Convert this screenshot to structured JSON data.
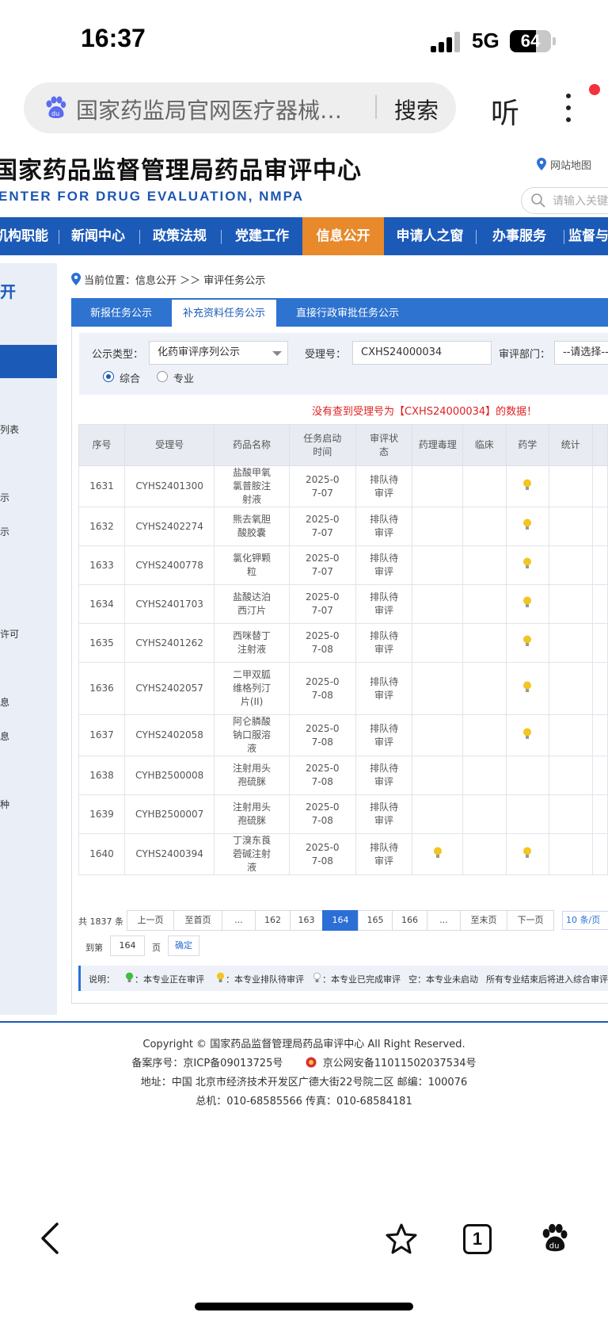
{
  "status_bar": {
    "time": "16:37",
    "network": "5G",
    "battery": "64",
    "battery_level": 0.64
  },
  "browser": {
    "search_query": "国家药监局官网医疗器械…",
    "search_label": "搜索",
    "listen_label": "听"
  },
  "site": {
    "title": "国家药品监督管理局药品审评中心",
    "subtitle": "ENTER FOR DRUG EVALUATION, NMPA",
    "sitemap": "网站地图",
    "search_placeholder": "请输入关键词"
  },
  "nav": [
    "机构职能",
    "新闻中心",
    "政策法规",
    "党建工作",
    "信息公开",
    "申请人之窗",
    "办事服务",
    "监督与"
  ],
  "sidebar": {
    "heading": "开",
    "items": [
      "列表",
      "示",
      "示",
      "许可",
      "息",
      "息",
      "种"
    ]
  },
  "breadcrumb": "当前位置：信息公开 ＞＞ 审评任务公示",
  "tabs": [
    "新报任务公示",
    "补充资料任务公示",
    "直接行政审批任务公示"
  ],
  "filters": {
    "type_label": "公示类型：",
    "type_value": "化药审评序列公示",
    "accept_label": "受理号：",
    "accept_value": "CXHS24000034",
    "dept_label": "审评部门：",
    "dept_value": "--请选择--",
    "radio_all": "综合",
    "radio_major": "专业"
  },
  "not_found": "没有查到受理号为【CXHS24000034】的数据！",
  "table": {
    "headers": [
      "序号",
      "受理号",
      "药品名称",
      "任务启动时间",
      "审评状态",
      "药理毒理",
      "临床",
      "药学",
      "统计",
      ""
    ],
    "rows": [
      {
        "no": "1631",
        "accept": "CYHS2401300",
        "name": "盐酸甲氧氯普胺注射液",
        "date": "2025-07-07",
        "status": "排队待审评",
        "tox": false,
        "pharm": true
      },
      {
        "no": "1632",
        "accept": "CYHS2402274",
        "name": "熊去氧胆酸胶囊",
        "date": "2025-07-07",
        "status": "排队待审评",
        "tox": false,
        "pharm": true
      },
      {
        "no": "1633",
        "accept": "CYHS2400778",
        "name": "氯化钾颗粒",
        "date": "2025-07-07",
        "status": "排队待审评",
        "tox": false,
        "pharm": true
      },
      {
        "no": "1634",
        "accept": "CYHS2401703",
        "name": "盐酸达泊西汀片",
        "date": "2025-07-07",
        "status": "排队待审评",
        "tox": false,
        "pharm": true
      },
      {
        "no": "1635",
        "accept": "CYHS2401262",
        "name": "西咪替丁注射液",
        "date": "2025-07-08",
        "status": "排队待审评",
        "tox": false,
        "pharm": true
      },
      {
        "no": "1636",
        "accept": "CYHS2402057",
        "name": "二甲双胍维格列汀片(II)",
        "date": "2025-07-08",
        "status": "排队待审评",
        "tox": false,
        "pharm": true
      },
      {
        "no": "1637",
        "accept": "CYHS2402058",
        "name": "阿仑膦酸钠口服溶液",
        "date": "2025-07-08",
        "status": "排队待审评",
        "tox": false,
        "pharm": true
      },
      {
        "no": "1638",
        "accept": "CYHB2500008",
        "name": "注射用头孢硫脒",
        "date": "2025-07-08",
        "status": "排队待审评",
        "tox": false,
        "pharm": false
      },
      {
        "no": "1639",
        "accept": "CYHB2500007",
        "name": "注射用头孢硫脒",
        "date": "2025-07-08",
        "status": "排队待审评",
        "tox": false,
        "pharm": false
      },
      {
        "no": "1640",
        "accept": "CYHS2400394",
        "name": "丁溴东莨菪碱注射液",
        "date": "2025-07-08",
        "status": "排队待审评",
        "tox": true,
        "pharm": true
      }
    ]
  },
  "pagination": {
    "total": "共 1837 条",
    "prev": "上一页",
    "first": "至首页",
    "ellipsis": "...",
    "pages": [
      "162",
      "163",
      "164",
      "165",
      "166"
    ],
    "current": "164",
    "last": "至末页",
    "next": "下一页",
    "page_size": "10 条/页",
    "goto_prefix": "到第",
    "goto_value": "164",
    "goto_suffix": "页",
    "confirm": "确定"
  },
  "legend": {
    "title": "说明：",
    "in_review": "：本专业正在审评",
    "queued": "：本专业排队待审评",
    "done": "：本专业已完成审评",
    "empty": "空：本专业未启动",
    "note": "所有专业结束后将进入综合审评阶段"
  },
  "footer": {
    "copyright": "Copyright © 国家药品监督管理局药品审评中心    All Right Reserved.",
    "icp": "备案序号：京ICP备09013725号",
    "police": "京公网安备11011502037534号",
    "address": "地址：中国 北京市经济技术开发区广德大街22号院二区      邮编：100076",
    "phone": "总机：010-68585566      传真：010-68584181"
  },
  "colors": {
    "brand": "#1c5ab8",
    "active_nav": "#e8892b",
    "error": "#e02020",
    "bulb_queued": "#f3c520",
    "bulb_in_review": "#3cbf3c"
  },
  "toolbar": {
    "tabs_count": "1"
  }
}
